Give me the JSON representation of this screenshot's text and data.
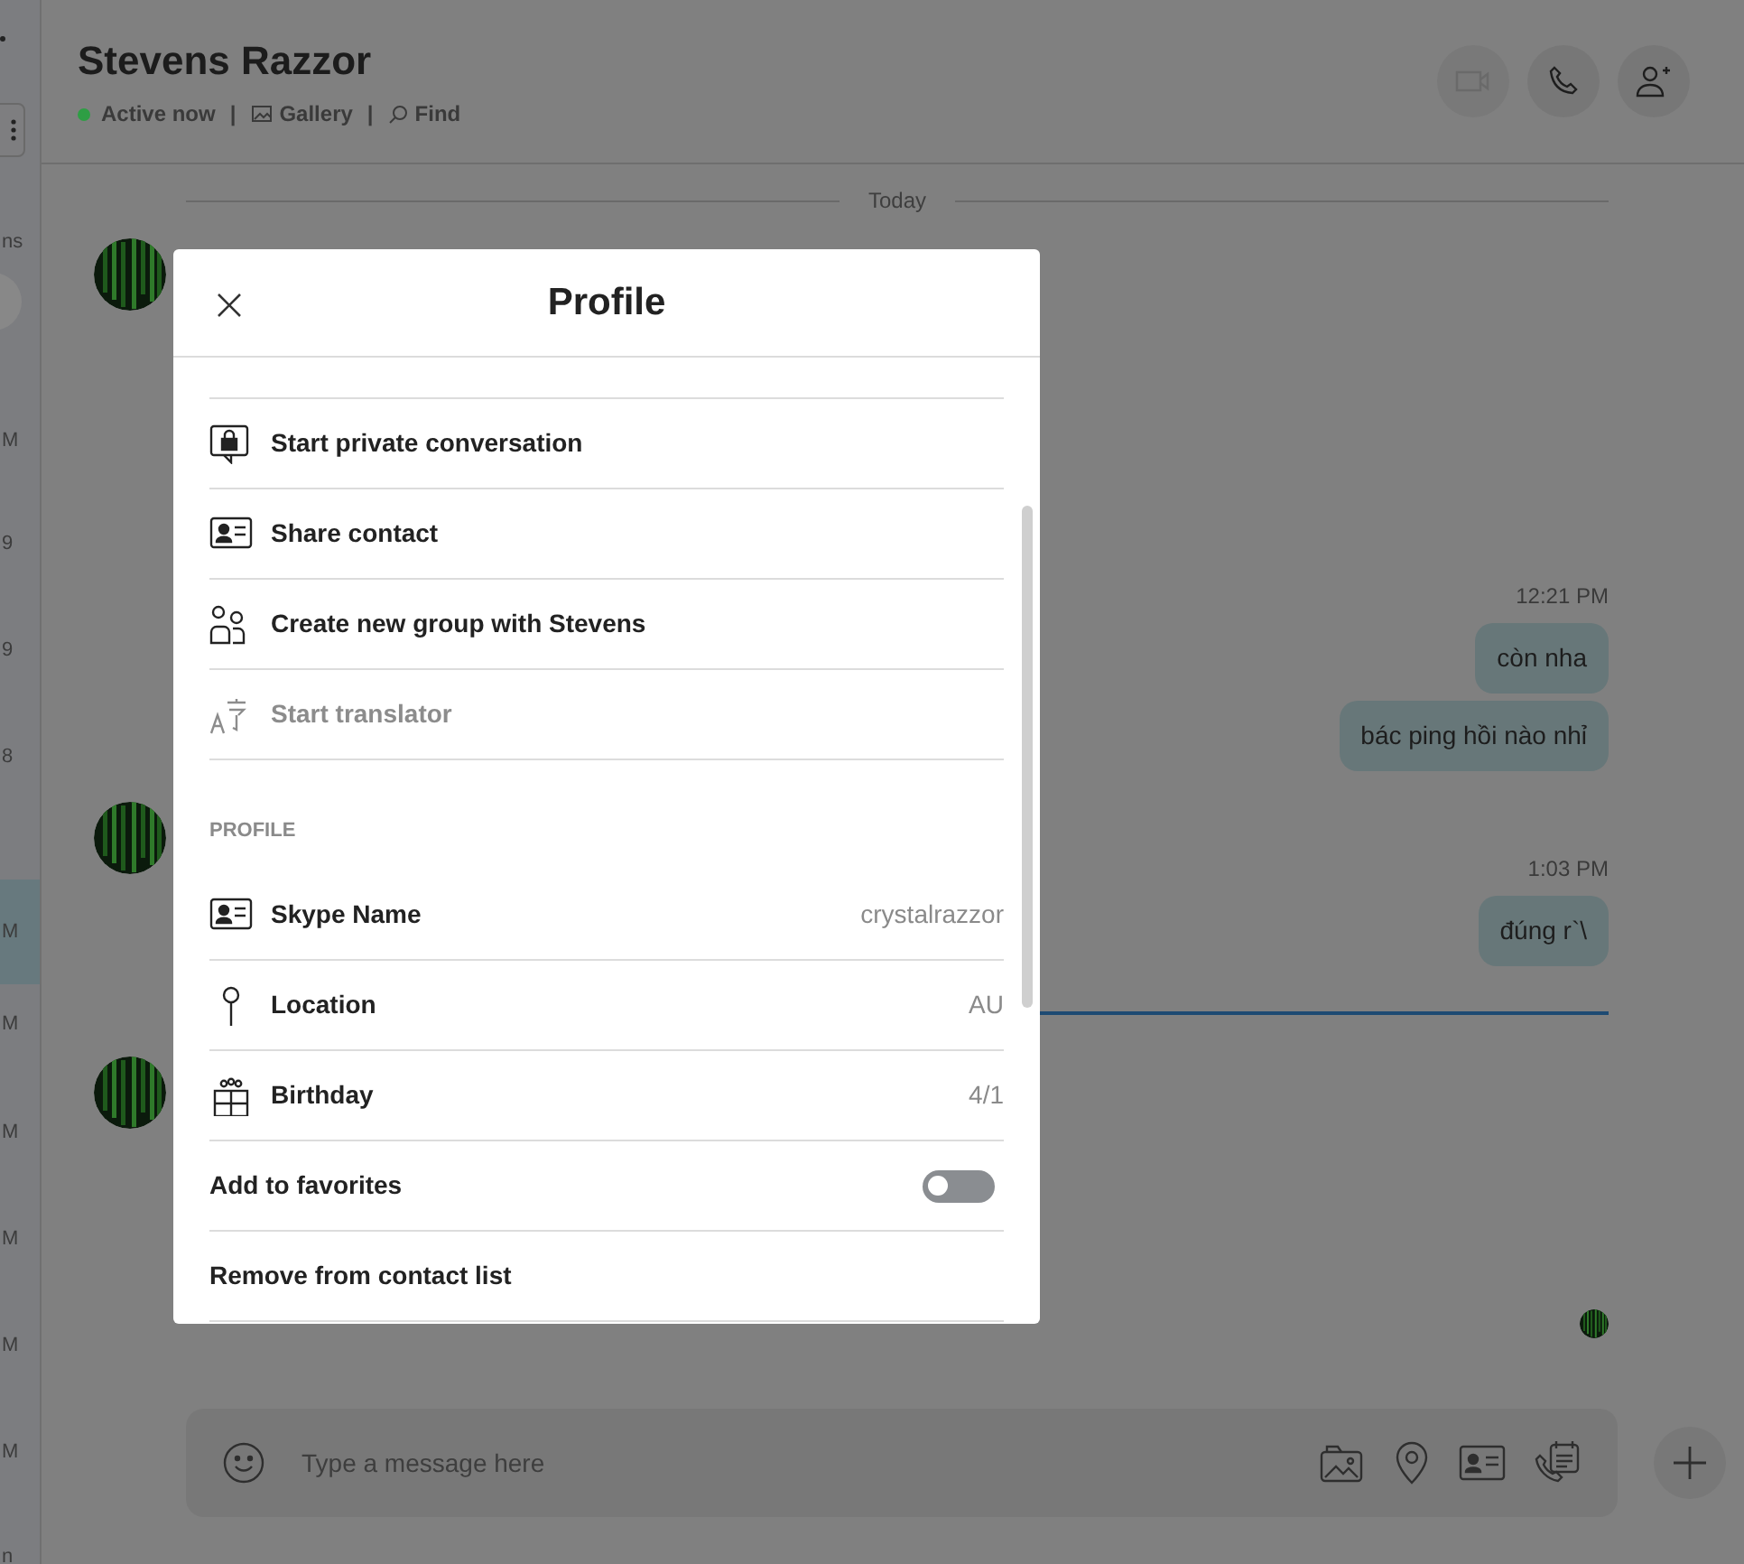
{
  "sidebar": {
    "items": [
      {
        "text": "ns",
        "selected": false
      },
      {
        "text": "M",
        "selected": false
      },
      {
        "text": "9",
        "selected": false
      },
      {
        "text": "9",
        "selected": false
      },
      {
        "text": "8",
        "selected": false
      },
      {
        "text": "M",
        "selected": true
      },
      {
        "text": "M",
        "selected": false
      },
      {
        "text": "M",
        "selected": false
      },
      {
        "text": "M",
        "selected": false
      },
      {
        "text": "M",
        "selected": false
      },
      {
        "text": "M",
        "selected": false
      },
      {
        "text": "n",
        "selected": false
      }
    ]
  },
  "header": {
    "title": "Stevens Razzor",
    "status": "Active now",
    "links": [
      "Gallery",
      "Find"
    ],
    "separator": "|"
  },
  "chat": {
    "divider": "Today",
    "groups": [
      {
        "time": "12:21 PM",
        "bubbles": [
          "còn nha",
          "bác ping hồi nào nhỉ"
        ]
      },
      {
        "time": "1:03 PM",
        "bubbles": [
          "đúng r`\\"
        ]
      }
    ],
    "composer": {
      "placeholder": "Type a message here"
    }
  },
  "dialog": {
    "title": "Profile",
    "rows": [
      {
        "kind": "action",
        "label": "Start private conversation",
        "disabled": false
      },
      {
        "kind": "action",
        "label": "Share contact",
        "disabled": false
      },
      {
        "kind": "action",
        "label": "Create new group with Stevens",
        "disabled": false
      },
      {
        "kind": "action",
        "label": "Start translator",
        "disabled": true
      },
      {
        "kind": "section",
        "label": "PROFILE"
      },
      {
        "kind": "field",
        "label": "Skype Name",
        "value": "crystalrazzor"
      },
      {
        "kind": "field",
        "label": "Location",
        "value": "AU"
      },
      {
        "kind": "field",
        "label": "Birthday",
        "value": "4/1"
      },
      {
        "kind": "toggle",
        "label": "Add to favorites",
        "on": false
      },
      {
        "kind": "action",
        "label": "Remove from contact list",
        "disabled": false
      }
    ]
  }
}
